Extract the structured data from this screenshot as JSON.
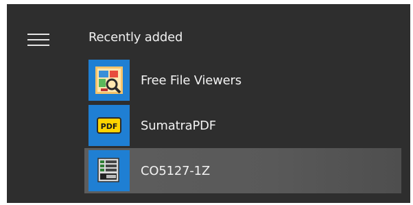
{
  "start_menu": {
    "section_title": "Recently added",
    "menu_icon": "hamburger-menu-icon",
    "apps": [
      {
        "label": "Free File Viewers",
        "icon": "file-viewers-icon"
      },
      {
        "label": "SumatraPDF",
        "icon": "sumatrapdf-icon",
        "icon_text": "PDF"
      },
      {
        "label": "CO5127-1Z",
        "icon": "co5127-app-icon",
        "highlighted": true
      }
    ],
    "colors": {
      "panel_bg": "#2e2e2e",
      "tile_blue": "#1f7fd3",
      "highlight": "#5d5d5d",
      "text": "#f2f2f2"
    }
  }
}
